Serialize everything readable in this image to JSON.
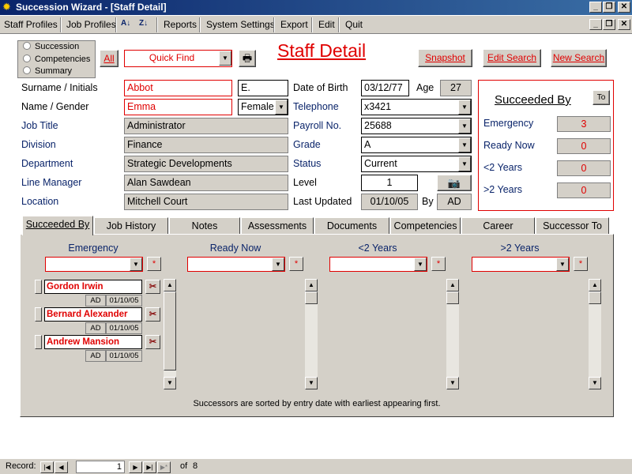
{
  "window": {
    "title": "Succession Wizard - [Staff Detail]",
    "app_icon": "sun-icon",
    "min": "_",
    "max": "▫",
    "close": "✕"
  },
  "menu": [
    "Staff Profiles",
    "Job Profiles",
    "Reports",
    "System Settings",
    "Export",
    "Edit",
    "Quit"
  ],
  "view_options": {
    "items": [
      "Succession",
      "Competencies",
      "Summary"
    ]
  },
  "toolbar": {
    "all_label": "All",
    "quick_find_value": "Quick Find",
    "page_title": "Staff Detail",
    "snapshot_label": "Snapshot",
    "edit_search_label": "Edit Search",
    "new_search_label": "New Search"
  },
  "form": {
    "surname_label": "Surname / Initials",
    "surname": "Abbot",
    "initials": "E.",
    "name_label": "Name / Gender",
    "first_name": "Emma",
    "gender": "Female",
    "job_title_label": "Job Title",
    "job_title": "Administrator",
    "division_label": "Division",
    "division": "Finance",
    "department_label": "Department",
    "department": "Strategic Developments",
    "line_manager_label": "Line Manager",
    "line_manager": "Alan Sawdean",
    "location_label": "Location",
    "location": "Mitchell Court",
    "dob_label": "Date of Birth",
    "dob": "03/12/77",
    "age_label": "Age",
    "age": "27",
    "telephone_label": "Telephone",
    "telephone": "x3421",
    "payroll_label": "Payroll No.",
    "payroll": "25688",
    "grade_label": "Grade",
    "grade": "A",
    "status_label": "Status",
    "status": "Current",
    "level_label": "Level",
    "level": "1",
    "last_updated_label": "Last Updated",
    "last_updated": "01/10/05",
    "by_label": "By",
    "by": "AD"
  },
  "succeeded_box": {
    "title": "Succeeded By",
    "to_label": "To",
    "rows": [
      {
        "label": "Emergency",
        "value": "3"
      },
      {
        "label": "Ready Now",
        "value": "0"
      },
      {
        "label": "<2 Years",
        "value": "0"
      },
      {
        "label": ">2 Years",
        "value": "0"
      }
    ]
  },
  "tabs": [
    "Succeeded By",
    "Job History",
    "Notes",
    "Assessments",
    "Documents",
    "Competencies",
    "Career",
    "Successor To"
  ],
  "columns": [
    "Emergency",
    "Ready Now",
    "<2 Years",
    ">2 Years"
  ],
  "successors": [
    {
      "name": "Gordon Irwin",
      "by": "AD",
      "date": "01/10/05"
    },
    {
      "name": "Bernard Alexander",
      "by": "AD",
      "date": "01/10/05"
    },
    {
      "name": "Andrew Mansion",
      "by": "AD",
      "date": "01/10/05"
    }
  ],
  "footer_note": "Successors are sorted by entry date with earliest appearing first.",
  "statusbar": {
    "record_label": "Record:",
    "record_value": "1",
    "of_label": "of",
    "total": "8"
  }
}
